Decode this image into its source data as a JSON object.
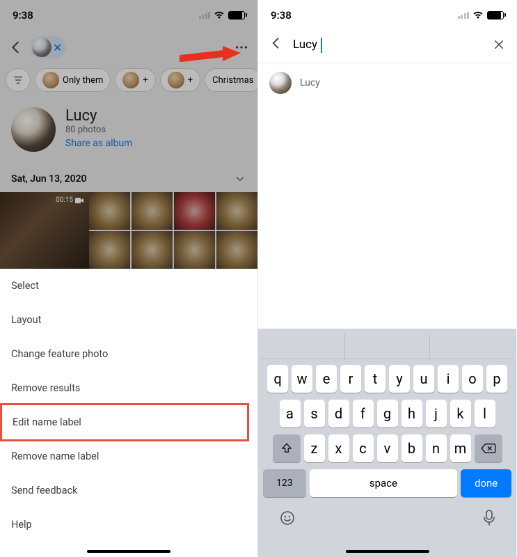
{
  "status": {
    "time": "9:38"
  },
  "left": {
    "profile": {
      "name": "Lucy",
      "sub": "80 photos",
      "link": "Share as album"
    },
    "chips": {
      "c0": "Only them",
      "c1": "Christmas"
    },
    "date": "Sat, Jun 13, 2020",
    "video_duration": "00:15",
    "menu": {
      "m0": "Select",
      "m1": "Layout",
      "m2": "Change feature photo",
      "m3": "Remove results",
      "m4": "Edit name label",
      "m5": "Remove name label",
      "m6": "Send feedback",
      "m7": "Help"
    }
  },
  "right": {
    "search_value": "Lucy",
    "suggestion": "Lucy"
  },
  "keyboard": {
    "row1": [
      "q",
      "w",
      "e",
      "r",
      "t",
      "y",
      "u",
      "i",
      "o",
      "p"
    ],
    "row2": [
      "a",
      "s",
      "d",
      "f",
      "g",
      "h",
      "j",
      "k",
      "l"
    ],
    "row3": [
      "z",
      "x",
      "c",
      "v",
      "b",
      "n",
      "m"
    ],
    "k123": "123",
    "space": "space",
    "done": "done"
  }
}
